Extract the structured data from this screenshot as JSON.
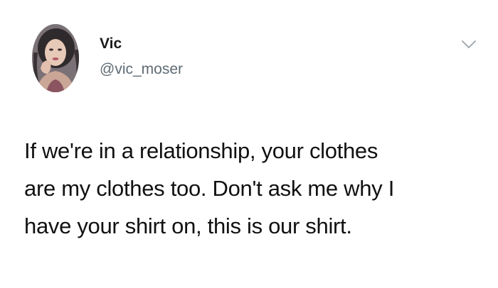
{
  "author": {
    "display_name": "Vic",
    "handle": "@vic_moser",
    "avatar_icon": "profile-photo"
  },
  "menu": {
    "icon": "chevron-down-icon"
  },
  "tweet": {
    "lines": [
      "If we're in a relationship, your clothes",
      "are my clothes too. Don't ask me why I",
      "have your shirt on, this is our shirt."
    ]
  }
}
